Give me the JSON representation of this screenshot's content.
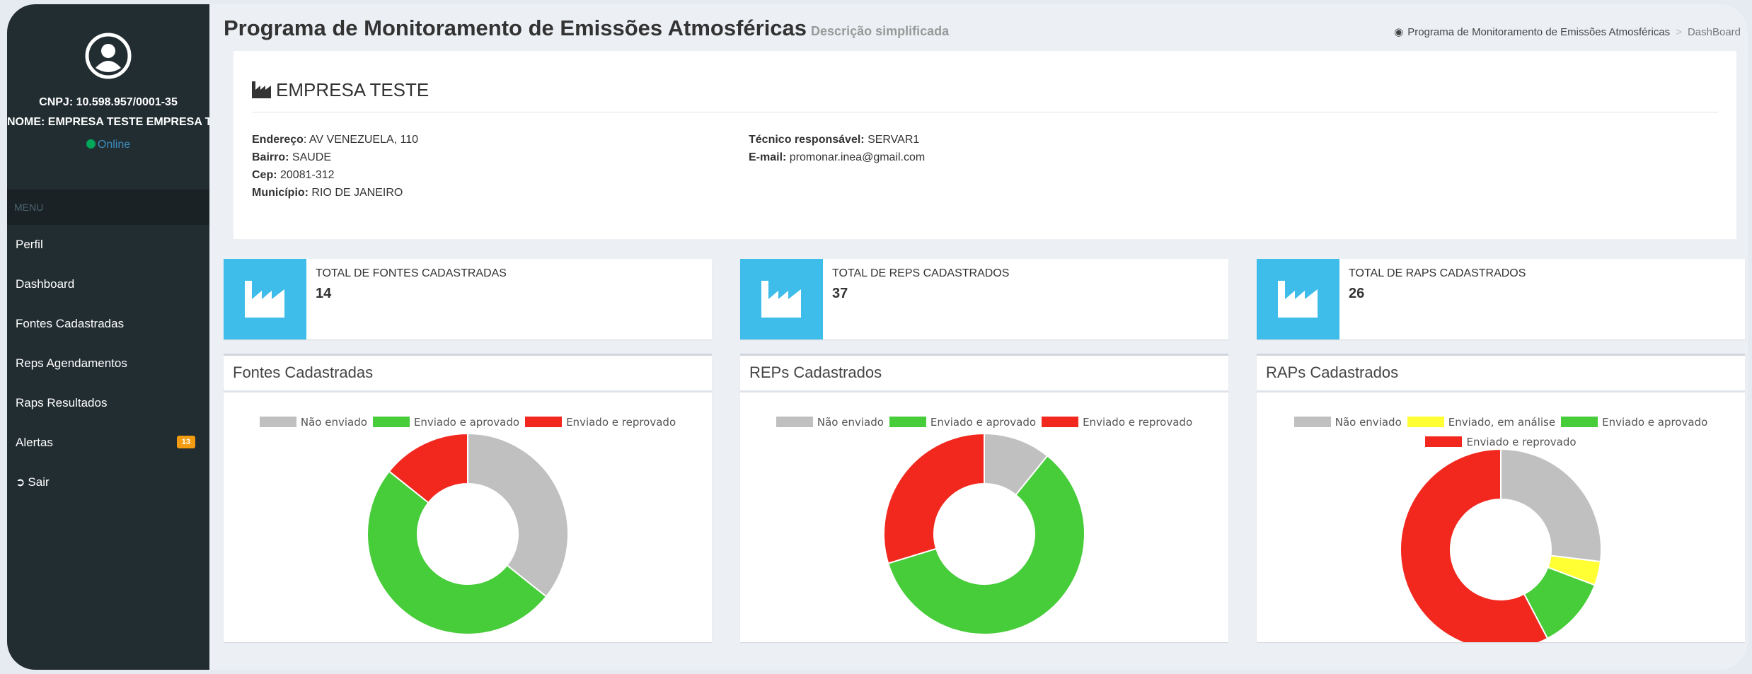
{
  "sidebar": {
    "cnpj": "CNPJ: 10.598.957/0001-35",
    "name": "NOME: EMPRESA TESTE EMPRESA TESTE",
    "status": "Online",
    "menu_header": "MENU",
    "items": [
      {
        "label": "Perfil"
      },
      {
        "label": "Dashboard"
      },
      {
        "label": "Fontes Cadastradas"
      },
      {
        "label": "Reps Agendamentos"
      },
      {
        "label": "Raps Resultados"
      },
      {
        "label": "Alertas",
        "badge": "13"
      },
      {
        "label": "Sair"
      }
    ]
  },
  "header": {
    "title": "Programa de Monitoramento de Emissões Atmosféricas",
    "subtitle": "Descrição simplificada",
    "breadcrumb": [
      "Programa de Monitoramento de Emissões Atmosféricas",
      "DashBoard"
    ]
  },
  "company": {
    "title": "EMPRESA TESTE",
    "address_label": "Endereço",
    "address": ": AV VENEZUELA, 110",
    "bairro_label": "Bairro:",
    "bairro": " SAUDE",
    "cep_label": "Cep:",
    "cep": " 20081-312",
    "municipio_label": "Município:",
    "municipio": " RIO DE JANEIRO",
    "tecnico_label": "Técnico responsável:",
    "tecnico": " SERVAR1",
    "email_label": "E-mail:",
    "email": " promonar.inea@gmail.com"
  },
  "stats": [
    {
      "label": "TOTAL DE FONTES CADASTRADAS",
      "value": "14"
    },
    {
      "label": "TOTAL DE REPS CADASTRADOS",
      "value": "37"
    },
    {
      "label": "TOTAL DE RAPS CADASTRADOS",
      "value": "26"
    }
  ],
  "colors": {
    "gray": "#c0c0c0",
    "yellow": "#ffff33",
    "green": "#47cc3a",
    "red": "#f2281e",
    "accent": "#3fbdea",
    "sidebar": "#222d32"
  },
  "chart_data": [
    {
      "type": "pie",
      "title": "Fontes Cadastradas",
      "categories": [
        "Não enviado",
        "Enviado e aprovado",
        "Enviado e reprovado"
      ],
      "values": [
        5,
        7,
        2
      ],
      "colors": [
        "#c0c0c0",
        "#47cc3a",
        "#f2281e"
      ]
    },
    {
      "type": "pie",
      "title": "REPs Cadastrados",
      "categories": [
        "Não enviado",
        "Enviado e aprovado",
        "Enviado e reprovado"
      ],
      "values": [
        4,
        22,
        11
      ],
      "colors": [
        "#c0c0c0",
        "#47cc3a",
        "#f2281e"
      ]
    },
    {
      "type": "pie",
      "title": "RAPs Cadastrados",
      "categories": [
        "Não enviado",
        "Enviado, em análise",
        "Enviado e aprovado",
        "Enviado e reprovado"
      ],
      "values": [
        7,
        1,
        3,
        15
      ],
      "colors": [
        "#c0c0c0",
        "#ffff33",
        "#47cc3a",
        "#f2281e"
      ]
    }
  ]
}
